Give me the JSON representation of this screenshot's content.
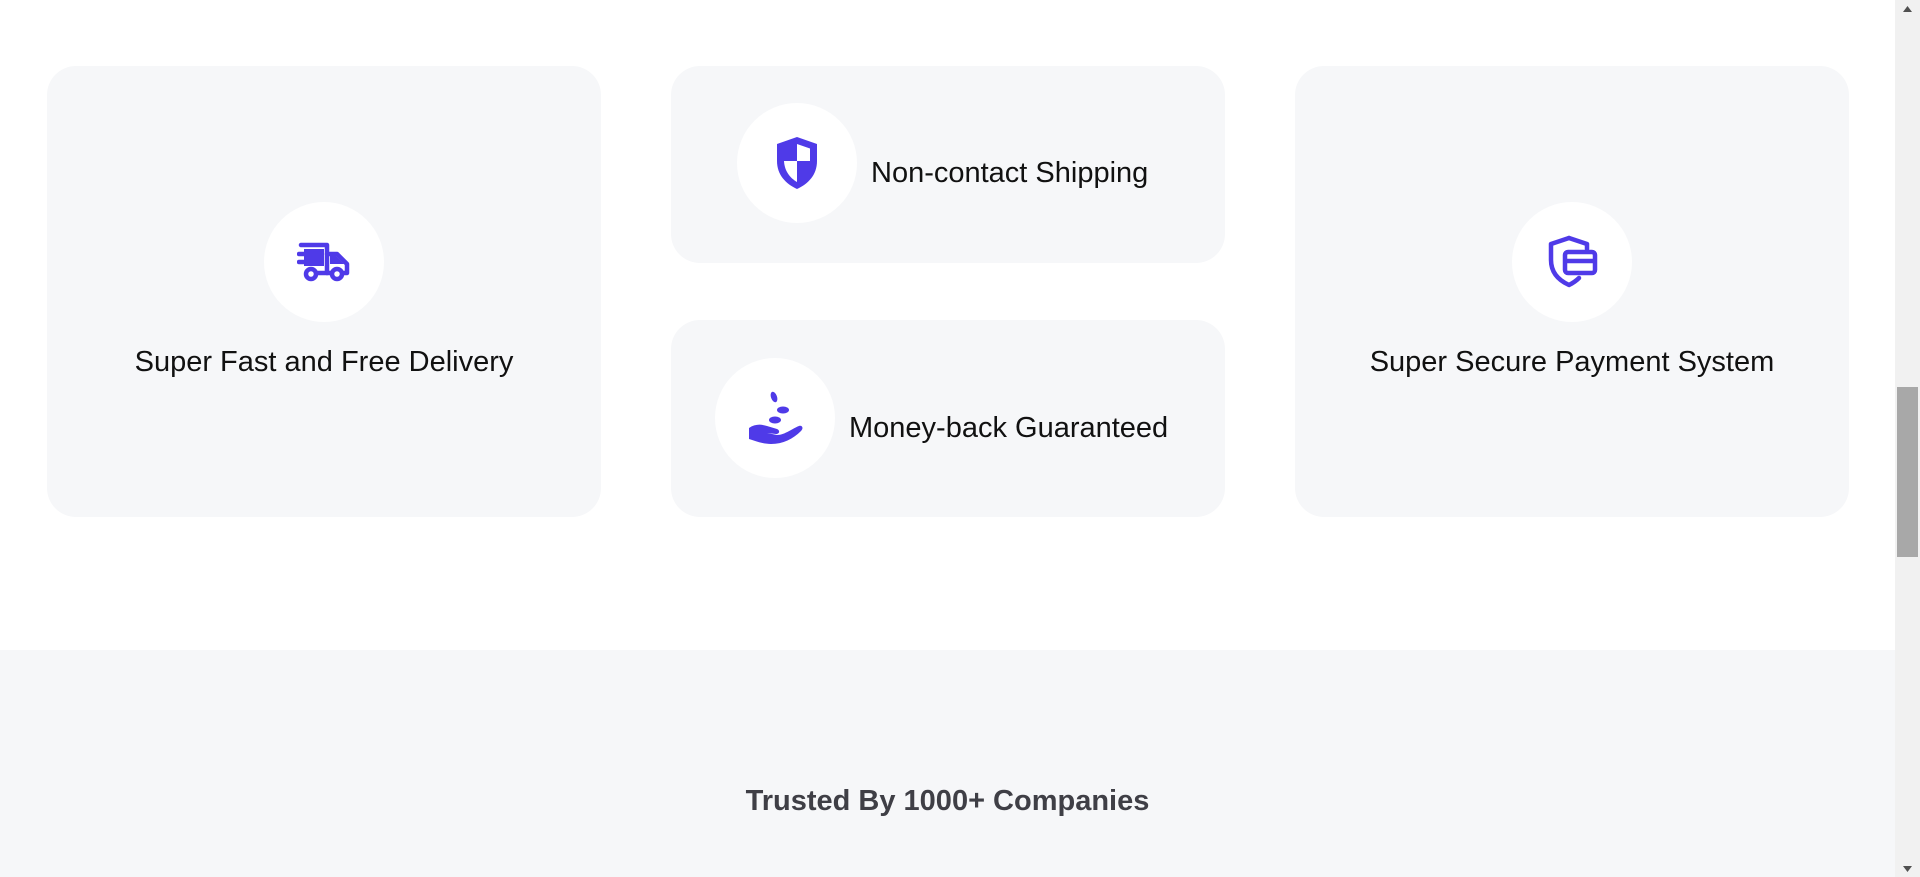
{
  "features": {
    "delivery": {
      "label": "Super Fast and Free Delivery",
      "icon": "truck-icon"
    },
    "shipping": {
      "label": "Non-contact Shipping",
      "icon": "shield-icon"
    },
    "money": {
      "label": "Money-back Guaranteed",
      "icon": "hand-coins-icon"
    },
    "secure": {
      "label": "Super Secure Payment System",
      "icon": "secure-card-icon"
    }
  },
  "trusted": {
    "title": "Trusted By 1000+ Companies"
  },
  "colors": {
    "accent": "#4f3ae8",
    "card_bg": "#f6f7f9",
    "heading": "#3f3f46"
  },
  "scrollbar": {
    "position_fraction": 0.55
  }
}
